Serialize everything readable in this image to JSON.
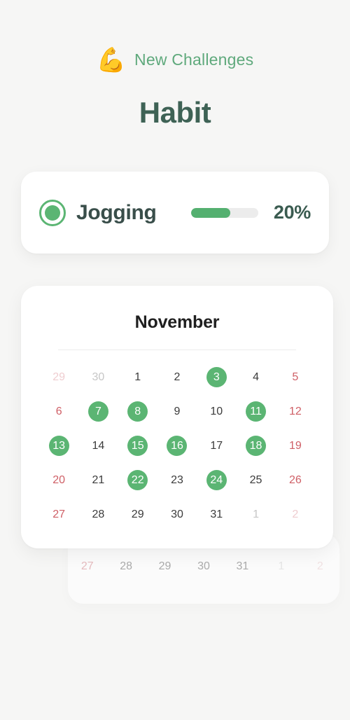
{
  "header": {
    "icon": "flexed-biceps-emoji",
    "icon_glyph": "💪",
    "subtitle": "New Challenges",
    "title": "Habit"
  },
  "habit_card": {
    "status_icon": "radio-selected-icon",
    "name": "Jogging",
    "progress_label": "20%",
    "progress_value": 20,
    "progress_fill_ratio": 58,
    "accent_color": "#5BB573"
  },
  "calendar": {
    "month": "November",
    "weeks": [
      [
        {
          "label": "29",
          "type": "out-weekend"
        },
        {
          "label": "30",
          "type": "out"
        },
        {
          "label": "1",
          "type": "normal"
        },
        {
          "label": "2",
          "type": "normal"
        },
        {
          "label": "3",
          "type": "done"
        },
        {
          "label": "4",
          "type": "normal"
        },
        {
          "label": "5",
          "type": "weekend"
        }
      ],
      [
        {
          "label": "6",
          "type": "weekend"
        },
        {
          "label": "7",
          "type": "done"
        },
        {
          "label": "8",
          "type": "done"
        },
        {
          "label": "9",
          "type": "normal"
        },
        {
          "label": "10",
          "type": "normal"
        },
        {
          "label": "11",
          "type": "done"
        },
        {
          "label": "12",
          "type": "weekend"
        }
      ],
      [
        {
          "label": "13",
          "type": "done"
        },
        {
          "label": "14",
          "type": "normal"
        },
        {
          "label": "15",
          "type": "done"
        },
        {
          "label": "16",
          "type": "done"
        },
        {
          "label": "17",
          "type": "normal"
        },
        {
          "label": "18",
          "type": "done"
        },
        {
          "label": "19",
          "type": "weekend"
        }
      ],
      [
        {
          "label": "20",
          "type": "weekend"
        },
        {
          "label": "21",
          "type": "normal"
        },
        {
          "label": "22",
          "type": "done"
        },
        {
          "label": "23",
          "type": "normal"
        },
        {
          "label": "24",
          "type": "done"
        },
        {
          "label": "25",
          "type": "normal"
        },
        {
          "label": "26",
          "type": "weekend"
        }
      ],
      [
        {
          "label": "27",
          "type": "weekend"
        },
        {
          "label": "28",
          "type": "normal"
        },
        {
          "label": "29",
          "type": "normal"
        },
        {
          "label": "30",
          "type": "normal"
        },
        {
          "label": "31",
          "type": "normal"
        },
        {
          "label": "1",
          "type": "out"
        },
        {
          "label": "2",
          "type": "out-weekend"
        }
      ]
    ]
  },
  "background_calendar": {
    "row": [
      {
        "label": "27",
        "type": "weekend"
      },
      {
        "label": "28",
        "type": "normal"
      },
      {
        "label": "29",
        "type": "normal"
      },
      {
        "label": "30",
        "type": "normal"
      },
      {
        "label": "31",
        "type": "normal"
      },
      {
        "label": "1",
        "type": "out"
      },
      {
        "label": "2",
        "type": "out-weekend"
      }
    ]
  },
  "colors": {
    "page_background": "#f6f6f5",
    "accent_green": "#5BB573",
    "subtitle_green": "#5FA97C",
    "title_dark_green": "#3E6255",
    "weekend_red": "#cf5f66",
    "muted_gray": "#c6c6c6"
  }
}
